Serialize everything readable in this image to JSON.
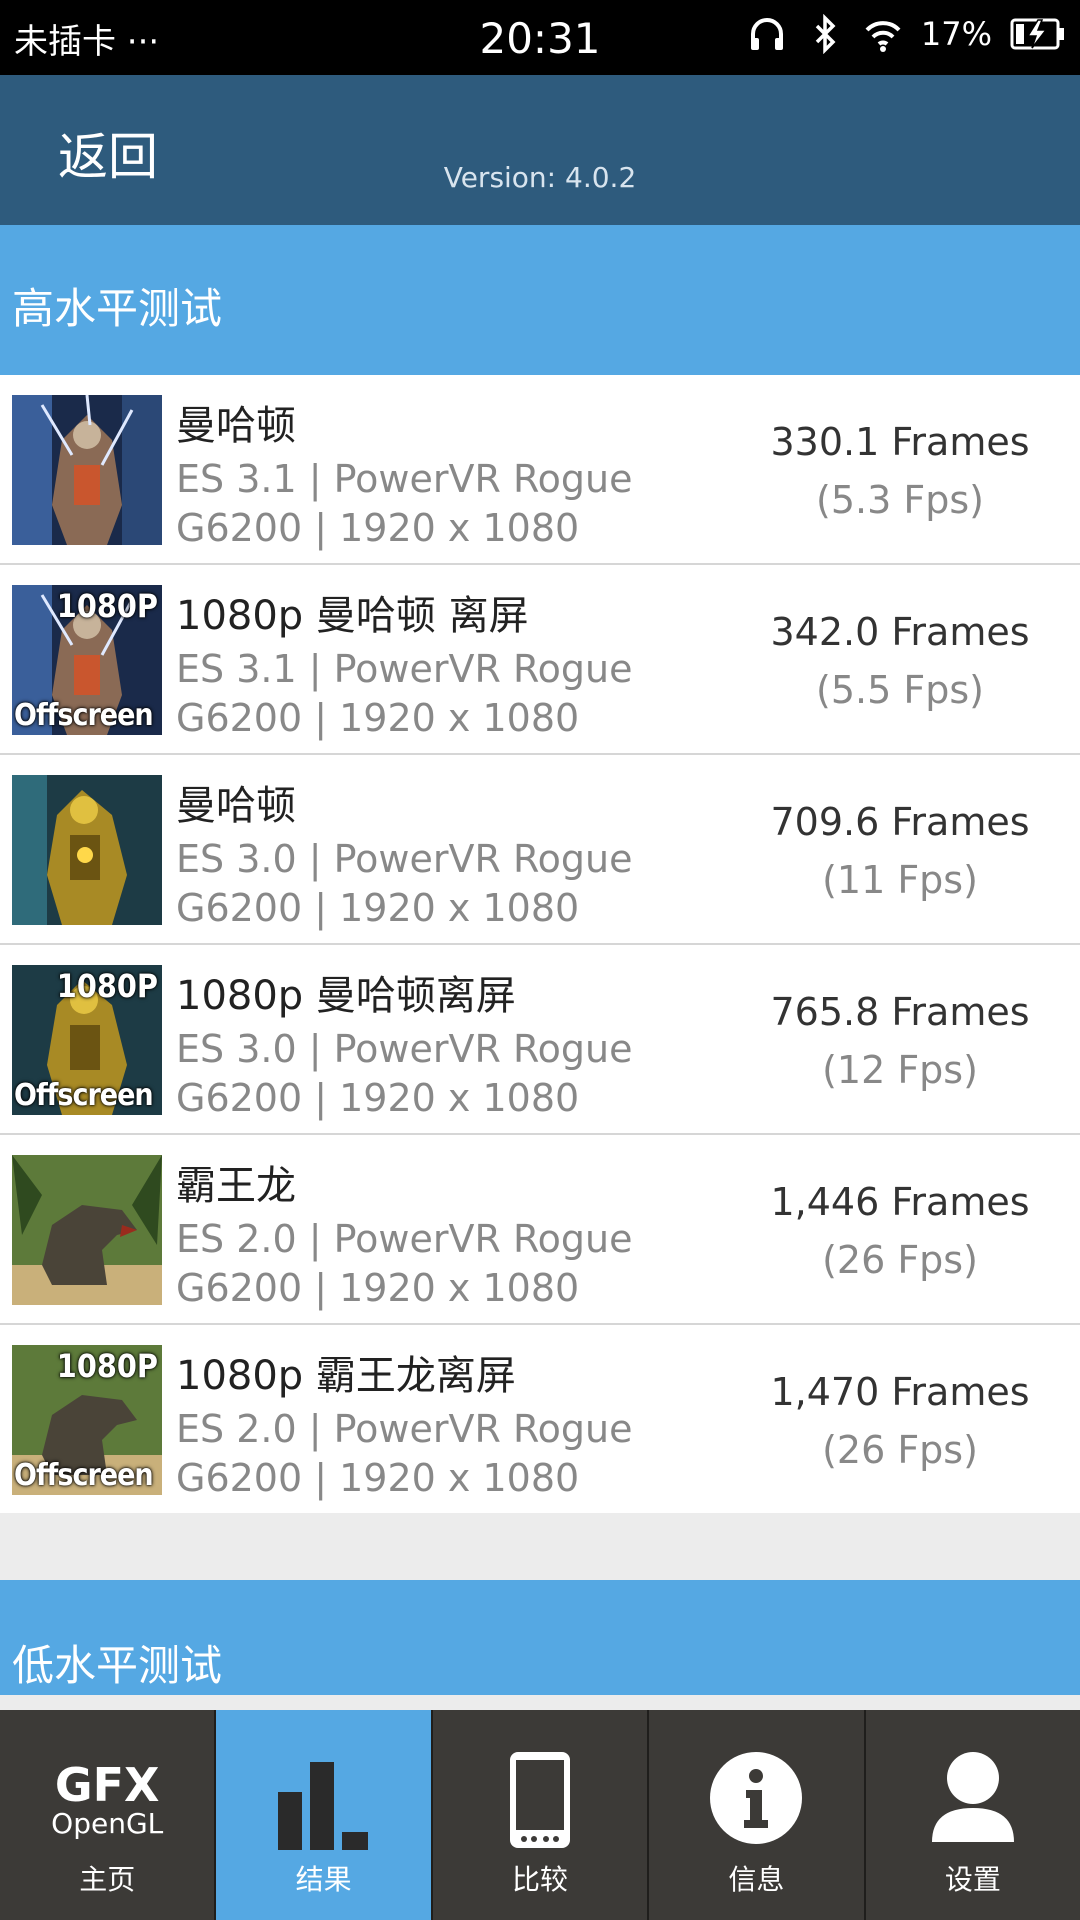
{
  "status_bar": {
    "carrier": "未插卡 ···",
    "time": "20:31",
    "battery": "17%",
    "icons": [
      "headphones-icon",
      "bluetooth-icon",
      "wifi-icon",
      "battery-charging-icon"
    ]
  },
  "header": {
    "back_label": "返回",
    "version": "Version: 4.0.2"
  },
  "high_level": {
    "title": "高水平测试",
    "items": [
      {
        "name": "曼哈顿",
        "line1": "ES 3.1 | PowerVR Rogue",
        "line2": "G6200 | 1920 x 1080",
        "frames": "330.1 Frames",
        "fps": "(5.3 Fps)",
        "thumb": "manhattan"
      },
      {
        "name": "1080p 曼哈顿 离屏",
        "line1": "ES 3.1 | PowerVR Rogue",
        "line2": "G6200 | 1920 x 1080",
        "frames": "342.0 Frames",
        "fps": "(5.5 Fps)",
        "thumb": "manhattan-offscreen",
        "tag_top": "1080P",
        "tag_bottom": "Offscreen"
      },
      {
        "name": "曼哈顿",
        "line1": "ES 3.0 | PowerVR Rogue",
        "line2": "G6200 | 1920 x 1080",
        "frames": "709.6 Frames",
        "fps": "(11 Fps)",
        "thumb": "manhattan30"
      },
      {
        "name": "1080p 曼哈顿离屏",
        "line1": "ES 3.0 | PowerVR Rogue",
        "line2": "G6200 | 1920 x 1080",
        "frames": "765.8 Frames",
        "fps": "(12 Fps)",
        "thumb": "manhattan30-offscreen",
        "tag_top": "1080P",
        "tag_bottom": "Offscreen"
      },
      {
        "name": "霸王龙",
        "line1": "ES 2.0 | PowerVR Rogue",
        "line2": "G6200 | 1920 x 1080",
        "frames": "1,446 Frames",
        "fps": "(26 Fps)",
        "thumb": "trex"
      },
      {
        "name": "1080p 霸王龙离屏",
        "line1": "ES 2.0 | PowerVR Rogue",
        "line2": "G6200 | 1920 x 1080",
        "frames": "1,470 Frames",
        "fps": "(26 Fps)",
        "thumb": "trex-offscreen",
        "tag_top": "1080P",
        "tag_bottom": "Offscreen"
      }
    ]
  },
  "low_level": {
    "title": "低水平测试"
  },
  "nav": {
    "logo_line1": "GFX",
    "logo_line2": "OpenGL",
    "items": [
      {
        "label": "主页",
        "icon": "gfx-logo-icon"
      },
      {
        "label": "结果",
        "icon": "bar-chart-icon",
        "active": true
      },
      {
        "label": "比较",
        "icon": "phone-icon"
      },
      {
        "label": "信息",
        "icon": "info-icon"
      },
      {
        "label": "设置",
        "icon": "user-icon"
      }
    ]
  },
  "colors": {
    "header": "#2e5b7d",
    "section": "#55a8e3",
    "nav": "#3c3a37"
  }
}
